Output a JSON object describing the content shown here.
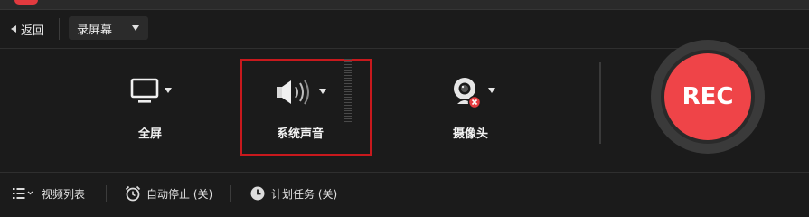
{
  "toolbar": {
    "back_label": "返回",
    "mode_select_value": "录屏幕"
  },
  "sources": {
    "screen": {
      "label": "全屏",
      "icon": "monitor-icon"
    },
    "audio": {
      "label": "系统声音",
      "icon": "speaker-icon"
    },
    "camera": {
      "label": "摄像头",
      "icon": "webcam-icon",
      "status": "disabled"
    }
  },
  "rec_button": {
    "label": "REC",
    "color": "#ef4448"
  },
  "bottom_bar": {
    "video_list_label": "视频列表",
    "auto_stop_label": "自动停止 (关)",
    "scheduled_task_label": "计划任务 (关)"
  },
  "colors": {
    "background": "#1b1b1b",
    "highlight_border": "#c8191d",
    "camera_off_badge": "#e53b3f"
  }
}
